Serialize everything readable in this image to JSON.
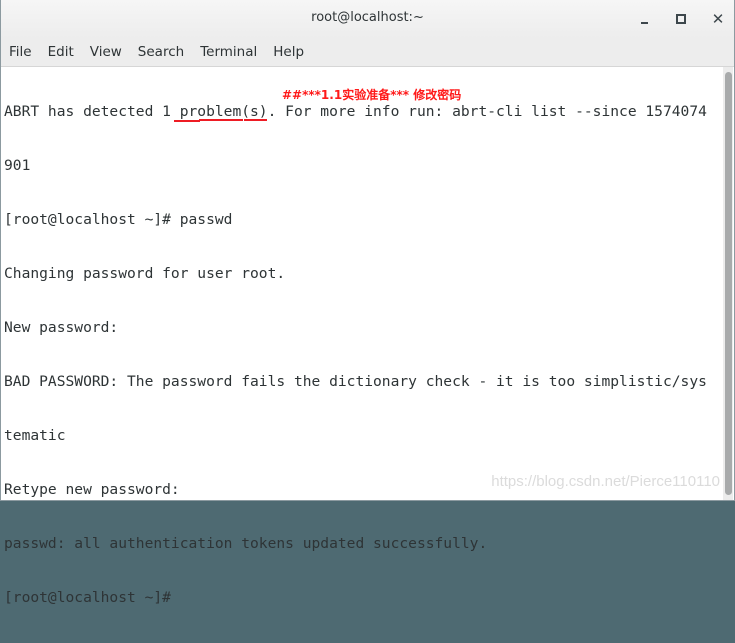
{
  "window": {
    "title": "root@localhost:~",
    "controls": {
      "minimize": "minimize-icon",
      "maximize": "maximize-icon",
      "close": "close-icon"
    }
  },
  "menubar": {
    "items": [
      "File",
      "Edit",
      "View",
      "Search",
      "Terminal",
      "Help"
    ]
  },
  "terminal": {
    "lines": [
      "ABRT has detected 1 problem(s). For more info run: abrt-cli list --since 1574074",
      "901",
      "[root@localhost ~]# passwd",
      "Changing password for user root.",
      "New password:",
      "BAD PASSWORD: The password fails the dictionary check - it is too simplistic/sys",
      "tematic",
      "Retype new password:",
      "passwd: all authentication tokens updated successfully.",
      "[root@localhost ~]#"
    ]
  },
  "annotation": {
    "text": "##***1.1实验准备*** 修改密码",
    "color": "#ff1a1a"
  },
  "watermark": {
    "text": "https://blog.csdn.net/Pierce110110"
  }
}
